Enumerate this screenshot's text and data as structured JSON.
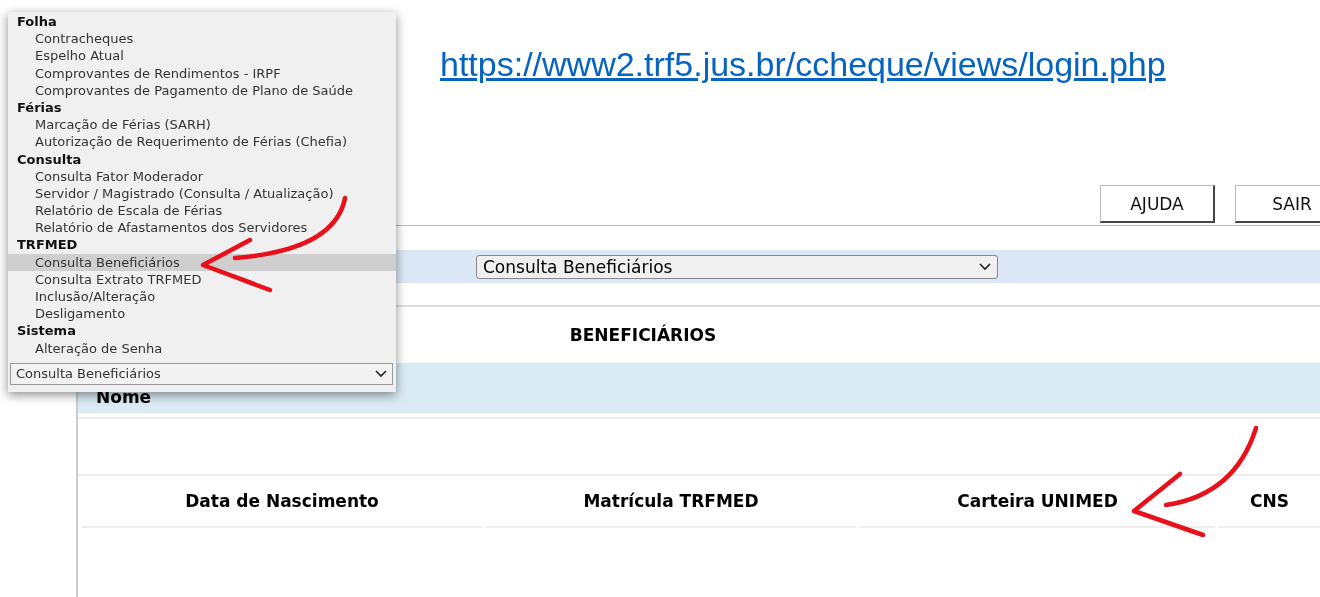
{
  "link": {
    "text": "https://www2.trf5.jus.br/ccheque/views/login.php"
  },
  "header_buttons": [
    "AJUDA",
    "SAIR"
  ],
  "menu_select": {
    "value": "Consulta Beneficiários"
  },
  "section_title": "BENEFICIÁRIOS",
  "name_header": "Nome",
  "columns": [
    "Data de Nascimento",
    "Matrícula TRFMED",
    "Carteira UNIMED",
    "CNS"
  ],
  "dropdown": {
    "value": "Consulta Beneficiários",
    "groups": [
      {
        "label": "Folha",
        "options": [
          {
            "label": "Contracheques",
            "selected": false
          },
          {
            "label": "Espelho Atual",
            "selected": false
          },
          {
            "label": "Comprovantes de Rendimentos - IRPF",
            "selected": false
          },
          {
            "label": "Comprovantes de Pagamento de Plano de Saúde",
            "selected": false
          }
        ]
      },
      {
        "label": "Férias",
        "options": [
          {
            "label": "Marcação de Férias (SARH)",
            "selected": false
          },
          {
            "label": "Autorização de Requerimento de Férias (Chefia)",
            "selected": false
          }
        ]
      },
      {
        "label": "Consulta",
        "options": [
          {
            "label": "Consulta Fator Moderador",
            "selected": false
          },
          {
            "label": "Servidor / Magistrado (Consulta / Atualização)",
            "selected": false
          },
          {
            "label": "Relatório de Escala de Férias",
            "selected": false
          },
          {
            "label": "Relatório de Afastamentos dos Servidores",
            "selected": false
          }
        ]
      },
      {
        "label": "TRFMED",
        "options": [
          {
            "label": "Consulta Beneficiários",
            "selected": true
          },
          {
            "label": "Consulta Extrato TRFMED",
            "selected": false
          },
          {
            "label": "Inclusão/Alteração",
            "selected": false
          },
          {
            "label": "Desligamento",
            "selected": false
          }
        ]
      },
      {
        "label": "Sistema",
        "options": [
          {
            "label": "Alteração de Senha",
            "selected": false
          }
        ]
      }
    ]
  }
}
